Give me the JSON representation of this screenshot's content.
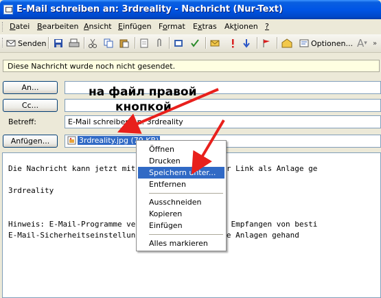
{
  "window": {
    "title": "E-Mail schreiben an: 3rdreality - Nachricht (Nur-Text)"
  },
  "menu": {
    "items": [
      {
        "pre": "",
        "key": "D",
        "post": "atei"
      },
      {
        "pre": "",
        "key": "B",
        "post": "earbeiten"
      },
      {
        "pre": "",
        "key": "A",
        "post": "nsicht"
      },
      {
        "pre": "",
        "key": "E",
        "post": "infügen"
      },
      {
        "pre": "F",
        "key": "o",
        "post": "rmat"
      },
      {
        "pre": "E",
        "key": "x",
        "post": "tras"
      },
      {
        "pre": "Ak",
        "key": "t",
        "post": "ionen"
      },
      {
        "pre": "",
        "key": "?",
        "post": ""
      }
    ]
  },
  "toolbar": {
    "send_label": "Senden",
    "options_label": "Optionen...",
    "font_glyph": "A"
  },
  "infobar": {
    "text": "Diese Nachricht wurde noch nicht gesendet."
  },
  "header": {
    "to_button": "An...",
    "cc_button": "Cc...",
    "subject_label": "Betreff:",
    "subject_value": "E-Mail schreiben an: 3rdreality",
    "attach_button": "Anfügen...",
    "attachment": "3rdreality.jpg (79 KB)"
  },
  "annotation": {
    "line1": "на файл правой",
    "line2": "кнопкой"
  },
  "body_lines": [
    "Die Nachricht kann jetzt mit folgender Datei oder Link als Anlage ge",
    "",
    "3rdreality",
    "",
    "",
    "Hinweis: E-Mail-Programme verhindern Senden oder Empfangen von besti",
    "E-Mail-Sicherheitseinstellungen zu ermitteln, wie Anlagen gehand"
  ],
  "context_menu": {
    "items": [
      "Öffnen",
      "Drucken",
      "Speichern unter...",
      "Entfernen",
      "Ausschneiden",
      "Kopieren",
      "Einfügen",
      "Alles markieren"
    ],
    "selected": "Speichern unter..."
  },
  "colors": {
    "titlebar": "#0055e5",
    "selection": "#316ac5",
    "arrow": "#e8201c",
    "infobar": "#ffffe1"
  }
}
